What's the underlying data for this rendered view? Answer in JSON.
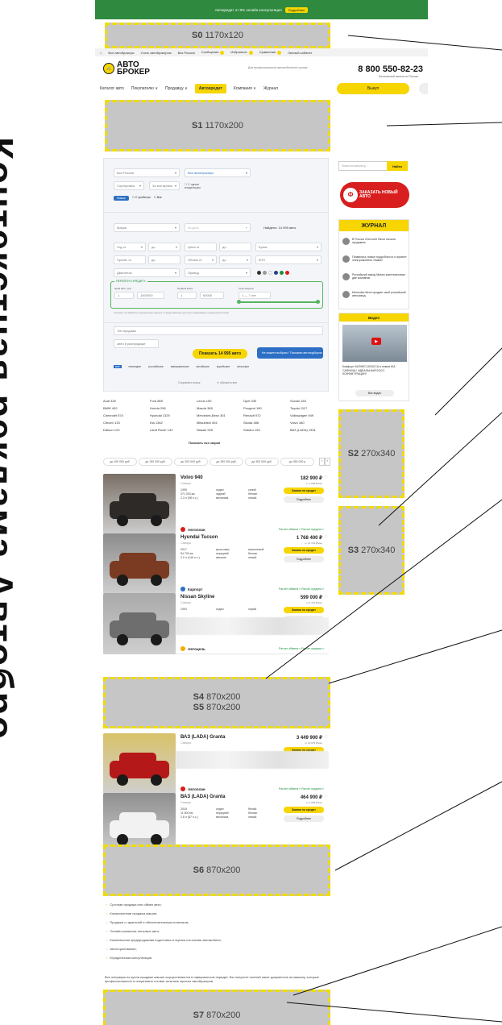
{
  "left_banner": {
    "text": "Контекстная реклама Автоброкер"
  },
  "topbar": {
    "text": "Автокредит от 8%  онлайн консультация",
    "button": "Подробнее"
  },
  "placeholders": {
    "s0": {
      "id": "S0",
      "size": "1170x120"
    },
    "s1": {
      "id": "S1",
      "size": "1170x200"
    },
    "s2": {
      "id": "S2",
      "size": "270x340"
    },
    "s3": {
      "id": "S3",
      "size": "270x340"
    },
    "s4": {
      "id": "S4",
      "size": "870x200"
    },
    "s5": {
      "id": "S5",
      "size": "870x200"
    },
    "s6": {
      "id": "S6",
      "size": "870x200"
    },
    "s7": {
      "id": "S7",
      "size": "870x200"
    }
  },
  "nav_strip": [
    "Все автоброкеры",
    "Стать автоброкером",
    "Вся Россия",
    "Сообщения",
    "Избранное",
    "Сравнение",
    "Личный кабинет"
  ],
  "logo": {
    "line1": "АВТО",
    "line2": "БРОКЕР"
  },
  "tagline": "Для профессионалов автомобильного рынка",
  "phone": "8 800 550-82-23",
  "phone_sub": "Бесплатный звонок по России",
  "menu": [
    "Каталог авто",
    "Покупателю ∨",
    "Продавцу ∨",
    "Автокредит",
    "Компания ∨",
    "Журнал"
  ],
  "exit_button": "Выкуп",
  "filter": {
    "region": "Вся Россия",
    "brokers": "Все автоброкеры",
    "sort": "Сортировка",
    "period": "За все время",
    "one_owner": "С одним владельцем",
    "tab_new": "Новые",
    "tab_used": "С пробегом",
    "tab_all": "Все",
    "brand": "Марка",
    "model": "Модель",
    "found": "Найдено: 14 995 авто",
    "year_from": "Год от",
    "to": "до",
    "price_from": "Цена от",
    "body": "Кузов",
    "mileage_from": "Пробег от",
    "volume_from": "Объем от",
    "transmission": "КПП",
    "engine": "Двигатель",
    "drive": "Привод",
    "credit_label": "ПЕРЕЙТИ К КРЕДИТУ",
    "car_price": "Цена авто, руб",
    "first_payment": "Первый взнос",
    "term": "Срок кредита",
    "term_value": "1 — 7 лет",
    "v1": "1",
    "v2": "1000000",
    "v3": "60000",
    "disclaimer": "Согласие на обработку персональных данных и предоставление доступа к информации о кредитной истории",
    "seller_type": "Тип продажи",
    "in_stock": "Авто в распродаже",
    "show_button": "Показать 14 995 авто",
    "help_banner": "Не можете выбрать? Поможем автоподбором",
    "flags": [
      "все",
      "немецкие",
      "российские",
      "американские",
      "китайские",
      "корейские",
      "японские"
    ],
    "save_search": "Сохранить поиск",
    "reset": "✕ сбросить все"
  },
  "brands": [
    "Audi 330",
    "Ford 869",
    "Lexus 190",
    "Opel 330",
    "Suzuki 183",
    "BMW 492",
    "Honda 298",
    "Mazda 365",
    "Peugeot 180",
    "Toyota 1117",
    "Chevrolet 574",
    "Hyundai 1329",
    "Mercedes-Benz 361",
    "Renault 972",
    "Volkswagen 949",
    "Citroen 133",
    "Kia 1362",
    "Mitsubishi 404",
    "Skoda 486",
    "Volvo 180",
    "Datsun 123",
    "Land Rover 132",
    "Nissan 925",
    "Subaru 153",
    "ВАЗ (LADA) 1531"
  ],
  "show_all_brands": "Показать все марки",
  "price_chips": [
    "до 100 000 руб.",
    "до 150 000 руб.",
    "до 200 000 руб.",
    "до 250 000 руб.",
    "до 300 000 руб.",
    "до 350 000 р"
  ],
  "cars": [
    {
      "title": "Volvo 940",
      "city": "Самара",
      "spec1": "1995\n371 000 км\n2.3 л (98 л.с.)",
      "spec2": "седан\nзадний\nмеханика",
      "spec3": "синий\nбензин\nлевый",
      "price": "182 900 ₽",
      "month": "от 1 828 ₽/мес",
      "dealer": "Автоплан",
      "dealer_color": "#d81e1e",
      "img_top": "#7a6f66",
      "img_car": "#2e2a28"
    },
    {
      "title": "Hyundai Tucson",
      "city": "Самара",
      "spec1": "2017\n54 700 км\n2.0 л (149 л.с.)",
      "spec2": "кроссовер\nпередний\nавтомат",
      "spec3": "коричневый\nбензин\nлевый",
      "price": "1 768 400 ₽",
      "month": "от 16 154 ₽/мес",
      "dealer": "Карпорт",
      "dealer_color": "#2c6fc5",
      "img_top": "#8c8c8c",
      "img_car": "#7a3b22"
    },
    {
      "title": "Nissan Skyline",
      "city": "Самара",
      "spec1": "1994",
      "spec2": "седан",
      "spec3": "серый",
      "price": "599 000 ₽",
      "month": "от 5 475 ₽/мес",
      "dealer": "Автоцель",
      "dealer_color": "#f6a800",
      "img_top": "#a9a9a9",
      "img_car": "#6e6e6e"
    },
    {
      "title": "ВАЗ (LADA) Granta",
      "city": "Самара",
      "spec1": "",
      "spec2": "",
      "spec3": "",
      "price": "3 449 900 ₽",
      "month": "от 20 879 ₽/мес",
      "dealer": "Автоплан",
      "dealer_color": "#d81e1e",
      "img_top": "#d9c26a",
      "img_car": "#b51818"
    },
    {
      "title": "ВАЗ (LADA) Granta",
      "city": "Самара",
      "spec1": "2018\n11 500 км\n1.6 л (87 л.с.)",
      "spec2": "седан\nпередний\nмеханика",
      "spec3": "белый\nбензин\nлевый",
      "price": "464 900 ₽",
      "month": "от 4 655 ₽/мес",
      "dealer": "Автоцель",
      "dealer_color": "#f6a800",
      "img_top": "#8f8f8f",
      "img_car": "#f2f2f2"
    }
  ],
  "card_labels": {
    "credit": "Заявка на кредит",
    "more": "Подробнее",
    "calc": "Расчет обмена »  Расчет кредита »"
  },
  "sidebar": {
    "search_placeholder": "Поиск по каталогу...",
    "find": "Найти",
    "order_banner": "ЗАКАЗАТЬ НОВЫЙ АВТО",
    "journal_title": "ЖУРНАЛ",
    "journal_items": [
      "В России Chevrolet Tahoe начали продавать",
      "Появились новые подробности о проекте электромобиля «Кама»",
      "Российский завод Nissan заинтересовал две компании",
      "Mercedes-Benz продает свой российский автозавод"
    ],
    "video_title": "Видео",
    "video_caption": "Комфорт БИЗНЕС-КЛАССА в новом KIA CARNIVAL! ИДЕАЛЬНЫЙ БОСС КОНФИГУРАЦИИ!",
    "all_video": "Все видео"
  },
  "services": [
    "Срочная продажа или обмен авто;",
    "Комиссионная продажа машин;",
    "Продажа с гарантией и обеспечительным платежом;",
    "Онлайн-комиссия легковых авто;",
    "Комплексная предпродажная подготовка и оценка состояния автомобиля;",
    "Автострахование;",
    "Юридическая консультация."
  ],
  "paragraph": "Все операции по купле-продаже машин осуществляются в официальном порядке. Вы получите полный пакет документов на машину, которые профессионально и оперативно готовят штатные юристы автоброкеров.",
  "colors": {
    "accent": "#f6d500",
    "green": "#2f8a3f",
    "placeholder": "#c6c6c6",
    "dash": "#f2dc00"
  }
}
